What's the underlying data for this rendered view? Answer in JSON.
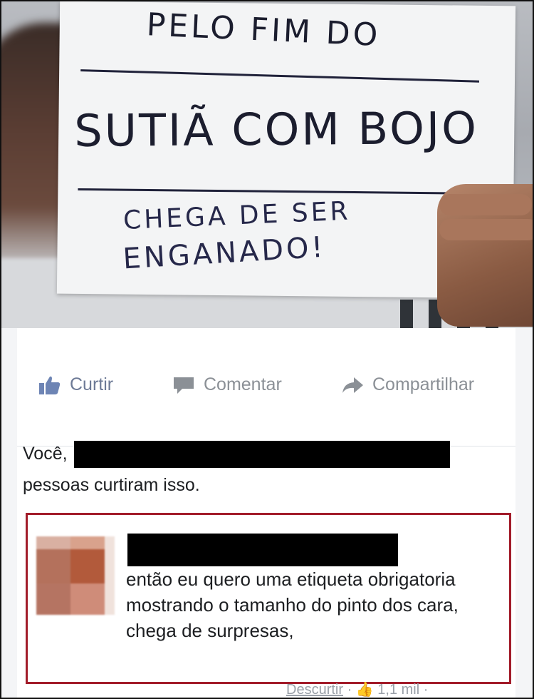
{
  "sign": {
    "line1": "PELO FIM DO",
    "line2": "SUTIÃ COM BOJO",
    "line3": "CHEGA DE SER",
    "line4": "ENGANADO!"
  },
  "actions": {
    "like_label": "Curtir",
    "comment_label": "Comentar",
    "share_label": "Compartilhar"
  },
  "likes": {
    "prefix": "Você,",
    "suffix": "pessoas curtiram isso."
  },
  "comment": {
    "text": "então eu quero uma etiqueta obrigatoria mostrando o tamanho do pinto dos cara, chega de surpresas,",
    "unlike_label": "Descurtir",
    "count": "1,1 mil"
  },
  "colors": {
    "highlight_border": "#a21c2a",
    "action_text": "#8b9096",
    "text": "#1c1e21"
  },
  "icons": [
    "thumbs-up-icon",
    "speech-bubble-icon",
    "share-arrow-icon"
  ]
}
